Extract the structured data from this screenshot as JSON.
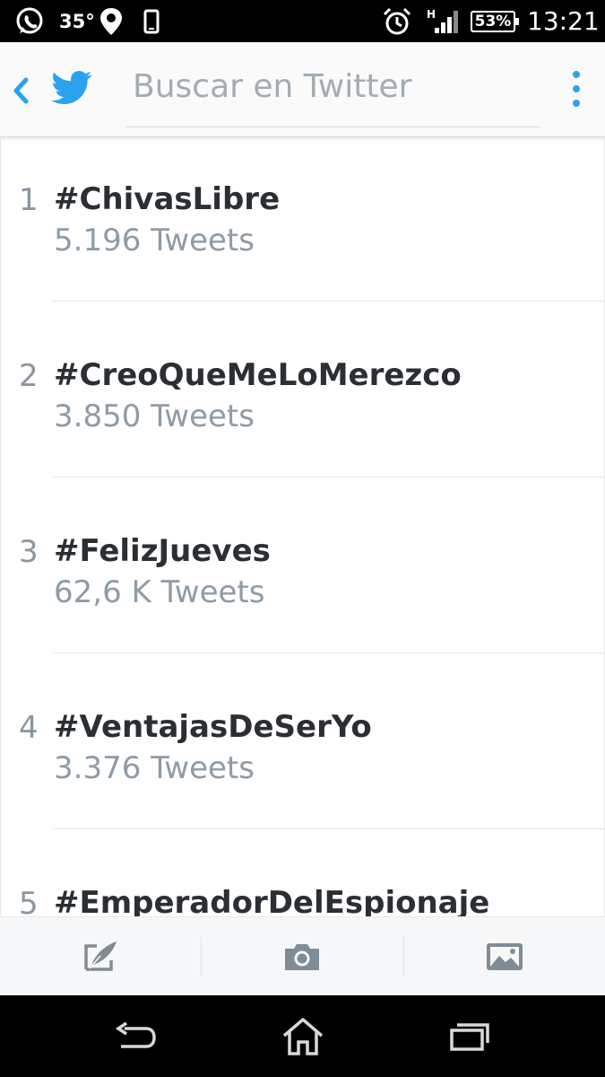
{
  "status_bar": {
    "temperature": "35°",
    "battery": "53%",
    "time": "13:21",
    "network_type": "H",
    "icons": [
      "whatsapp-icon",
      "location-icon",
      "phone-icon",
      "alarm-icon",
      "signal-icon",
      "battery-icon"
    ]
  },
  "header": {
    "search_placeholder": "Buscar en Twitter",
    "accent_color": "#2aa3ef"
  },
  "trends": [
    {
      "rank": "1",
      "name": "#ChivasLibre",
      "count": "5.196 Tweets"
    },
    {
      "rank": "2",
      "name": "#CreoQueMeLoMerezco",
      "count": "3.850 Tweets"
    },
    {
      "rank": "3",
      "name": "#FelizJueves",
      "count": "62,6 K Tweets"
    },
    {
      "rank": "4",
      "name": "#VentajasDeSerYo",
      "count": "3.376 Tweets"
    },
    {
      "rank": "5",
      "name": "#EmperadorDelEspionaje",
      "count": ""
    }
  ],
  "toolbar": {
    "icons": [
      "compose-icon",
      "camera-icon",
      "image-icon"
    ]
  },
  "nav_bar": {
    "icons": [
      "back-icon",
      "home-icon",
      "recents-icon"
    ]
  }
}
